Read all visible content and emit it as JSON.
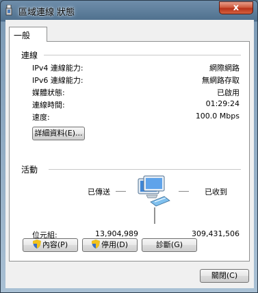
{
  "window": {
    "title": "區域連線 狀態",
    "close_glyph": "x"
  },
  "tabs": [
    {
      "label": "一般"
    }
  ],
  "connection": {
    "heading": "連線",
    "rows": [
      {
        "label": "IPv4 連線能力:",
        "value": "網際網路"
      },
      {
        "label": "IPv6 連線能力:",
        "value": "無網路存取"
      },
      {
        "label": "媒體狀態:",
        "value": "已啟用"
      },
      {
        "label": "連線時間:",
        "value": "01:29:24"
      },
      {
        "label": "速度:",
        "value": "100.0 Mbps"
      }
    ],
    "details_button": "詳細資料(E)..."
  },
  "activity": {
    "heading": "活動",
    "sent_label": "已傳送",
    "received_label": "已收到",
    "bytes_label": "位元組:",
    "sent_bytes": "13,904,989",
    "received_bytes": "309,431,506",
    "icon": "network-computers-icon"
  },
  "buttons": {
    "properties": "內容(P)",
    "disable": "停用(D)",
    "diagnose": "診斷(G)",
    "close": "關閉(C)"
  }
}
